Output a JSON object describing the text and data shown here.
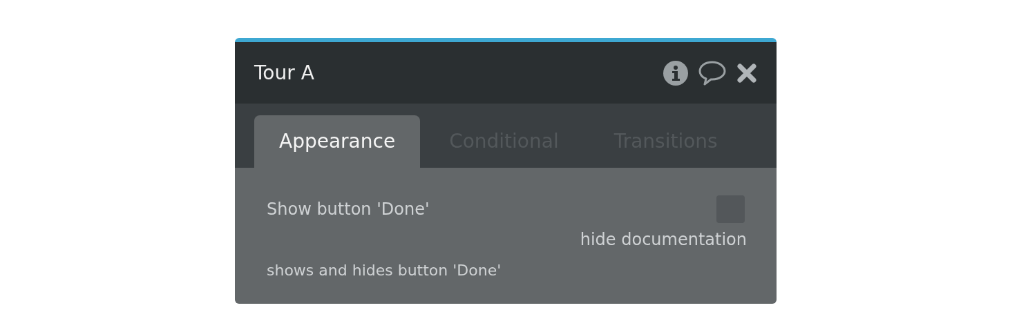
{
  "window": {
    "title": "Tour A"
  },
  "tabs": [
    {
      "label": "Appearance",
      "selected": true
    },
    {
      "label": "Conditional",
      "selected": false
    },
    {
      "label": "Transitions",
      "selected": false
    }
  ],
  "property": {
    "label": "Show button 'Done'",
    "checked": false,
    "doc_toggle": "hide documentation",
    "documentation": "shows and hides button 'Done'"
  }
}
